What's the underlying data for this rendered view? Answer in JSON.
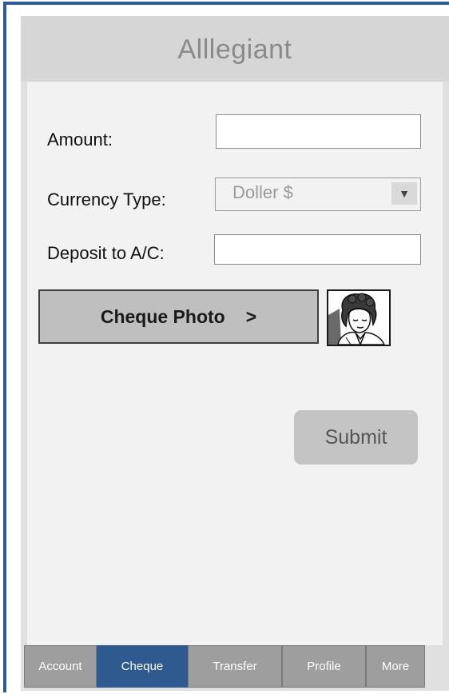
{
  "header": {
    "title": "Alllegiant"
  },
  "form": {
    "amount": {
      "label": "Amount:",
      "value": ""
    },
    "currency": {
      "label": "Currency Type:",
      "selected": "Doller $"
    },
    "deposit": {
      "label": "Deposit to A/C:",
      "value": ""
    }
  },
  "actions": {
    "cheque_photo_label": "Cheque Photo",
    "cheque_photo_chevron": ">",
    "submit_label": "Submit"
  },
  "tabs": [
    {
      "label": "Account",
      "active": false
    },
    {
      "label": "Cheque",
      "active": true
    },
    {
      "label": "Transfer",
      "active": false
    },
    {
      "label": "Profile",
      "active": false
    },
    {
      "label": "More",
      "active": false
    }
  ],
  "colors": {
    "accent": "#2e5a8f",
    "tab_inactive": "#9e9e9e",
    "button_gray": "#bfbfbf"
  },
  "icons": {
    "photo_thumbnail": "person-photo-icon",
    "dropdown": "triangle-down-icon"
  }
}
